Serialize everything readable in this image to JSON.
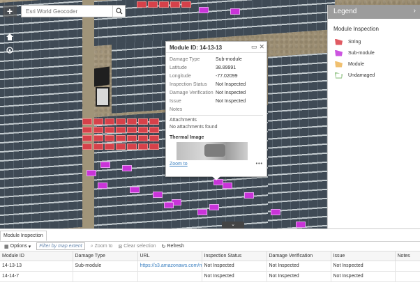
{
  "search": {
    "placeholder": "Esri World Geocoder"
  },
  "map_controls": {
    "zoom_in": "+"
  },
  "popup": {
    "title": "Module ID: 14-13-13",
    "fields": [
      {
        "key": "Damage Type",
        "value": "Sub-module"
      },
      {
        "key": "Latitude",
        "value": "38.89991"
      },
      {
        "key": "Longitude",
        "value": "-77.02099"
      },
      {
        "key": "Inspection Status",
        "value": "Not Inspected"
      },
      {
        "key": "Damage Verification",
        "value": "Not Inspected"
      },
      {
        "key": "Issue",
        "value": "Not Inspected"
      },
      {
        "key": "Notes",
        "value": ""
      }
    ],
    "attachments_label": "Attachments",
    "attachments_text": "No attachments found",
    "thermal_label": "Thermal Image",
    "zoom_to": "Zoom to",
    "more": "•••"
  },
  "legend": {
    "title": "Legend",
    "layer": "Module Inspection",
    "items": [
      {
        "label": "String",
        "color": "#e05a62"
      },
      {
        "label": "Sub-module",
        "color": "#cc55e0"
      },
      {
        "label": "Module",
        "color": "#f0c070"
      },
      {
        "label": "Undamaged",
        "color": "#7fb870"
      }
    ]
  },
  "table": {
    "tab": "Module Inspection",
    "toolbar": {
      "options": "Options",
      "filter": "Filter by map extent",
      "zoom_to": "Zoom to",
      "clear_selection": "Clear selection",
      "refresh": "Refresh"
    },
    "columns": [
      "Module ID",
      "Damage Type",
      "URL",
      "Inspection Status",
      "Damage Verification",
      "Issue",
      "Notes"
    ],
    "rows": [
      [
        "14-13-13",
        "Sub-module",
        "https://s3.amazonaws.com/me",
        "Not Inspected",
        "Not Inspected",
        "Not Inspected",
        ""
      ],
      [
        "14-14-7",
        "",
        "",
        "Not Inspected",
        "Not Inspected",
        "Not Inspected",
        ""
      ]
    ]
  },
  "colors": {
    "string": "#d6414a",
    "submodule": "#c934d8",
    "legend_header": "#9c9c9c",
    "link": "#3a7fc0"
  }
}
